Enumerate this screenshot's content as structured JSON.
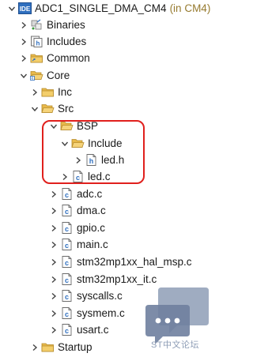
{
  "project": {
    "badge": "IDE",
    "name": "ADC1_SINGLE_DMA_CM4",
    "suffix": "(in CM4)"
  },
  "items": [
    {
      "label": "Binaries",
      "icon": "binaries-icon",
      "expander": "collapsed"
    },
    {
      "label": "Includes",
      "icon": "includes-icon",
      "expander": "collapsed"
    },
    {
      "label": "Common",
      "icon": "folder-icon",
      "expander": "collapsed"
    },
    {
      "label": "Core",
      "icon": "source-folder-icon",
      "expander": "expanded"
    },
    {
      "label": "Inc",
      "icon": "folder-icon",
      "expander": "collapsed"
    },
    {
      "label": "Src",
      "icon": "folder-icon",
      "expander": "expanded"
    },
    {
      "label": "BSP",
      "icon": "folder-icon",
      "expander": "expanded"
    },
    {
      "label": "Include",
      "icon": "folder-icon",
      "expander": "expanded"
    },
    {
      "label": "led.h",
      "icon": "header-file-icon",
      "expander": "collapsed"
    },
    {
      "label": "led.c",
      "icon": "c-file-icon",
      "expander": "collapsed"
    },
    {
      "label": "adc.c",
      "icon": "c-file-icon",
      "expander": "collapsed"
    },
    {
      "label": "dma.c",
      "icon": "c-file-icon",
      "expander": "collapsed"
    },
    {
      "label": "gpio.c",
      "icon": "c-file-icon",
      "expander": "collapsed"
    },
    {
      "label": "main.c",
      "icon": "c-file-icon",
      "expander": "collapsed"
    },
    {
      "label": "stm32mp1xx_hal_msp.c",
      "icon": "c-file-icon",
      "expander": "collapsed"
    },
    {
      "label": "stm32mp1xx_it.c",
      "icon": "c-file-icon",
      "expander": "collapsed"
    },
    {
      "label": "syscalls.c",
      "icon": "c-file-icon",
      "expander": "collapsed"
    },
    {
      "label": "sysmem.c",
      "icon": "c-file-icon",
      "expander": "collapsed"
    },
    {
      "label": "usart.c",
      "icon": "c-file-icon",
      "expander": "collapsed"
    },
    {
      "label": "Startup",
      "icon": "folder-icon",
      "expander": "collapsed"
    }
  ],
  "colors": {
    "highlight": "#e0201d",
    "folder": "#e8b94a",
    "accent_blue": "#2f6fbf",
    "watermark": "#8e9db6"
  },
  "watermark": {
    "text": "ST中文论坛"
  }
}
